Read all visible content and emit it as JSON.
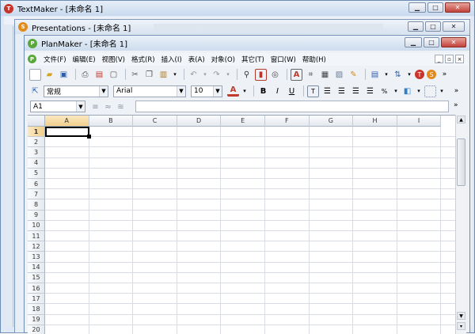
{
  "textmaker": {
    "title": "TextMaker - [未命名 1]"
  },
  "presentations": {
    "title": "Presentations - [未命名 1]"
  },
  "planmaker": {
    "title": "PlanMaker - [未命名 1]",
    "menu": [
      "文件(F)",
      "编辑(E)",
      "视图(V)",
      "格式(R)",
      "插入(I)",
      "表(A)",
      "对象(O)",
      "其它(T)",
      "窗口(W)",
      "帮助(H)"
    ],
    "style_value": "常规",
    "font_value": "Arial",
    "size_value": "10",
    "cell_ref": "A1",
    "columns": [
      "A",
      "B",
      "C",
      "D",
      "E",
      "F",
      "G",
      "H",
      "I"
    ],
    "rows": [
      "1",
      "2",
      "3",
      "4",
      "5",
      "6",
      "7",
      "8",
      "9",
      "10",
      "11",
      "12",
      "13",
      "14",
      "15",
      "16",
      "17",
      "18",
      "19",
      "20"
    ]
  },
  "icons": {
    "minimize": "minimize-icon",
    "maximize": "maximize-icon",
    "close": "close-icon",
    "more": "»"
  },
  "colors": {
    "titlebar_active": "#cfe0f2",
    "titlebar_inactive": "#e9eef4",
    "close_red": "#c2423a",
    "accent_orange": "#e38a1c",
    "accent_green": "#5aa83c"
  }
}
